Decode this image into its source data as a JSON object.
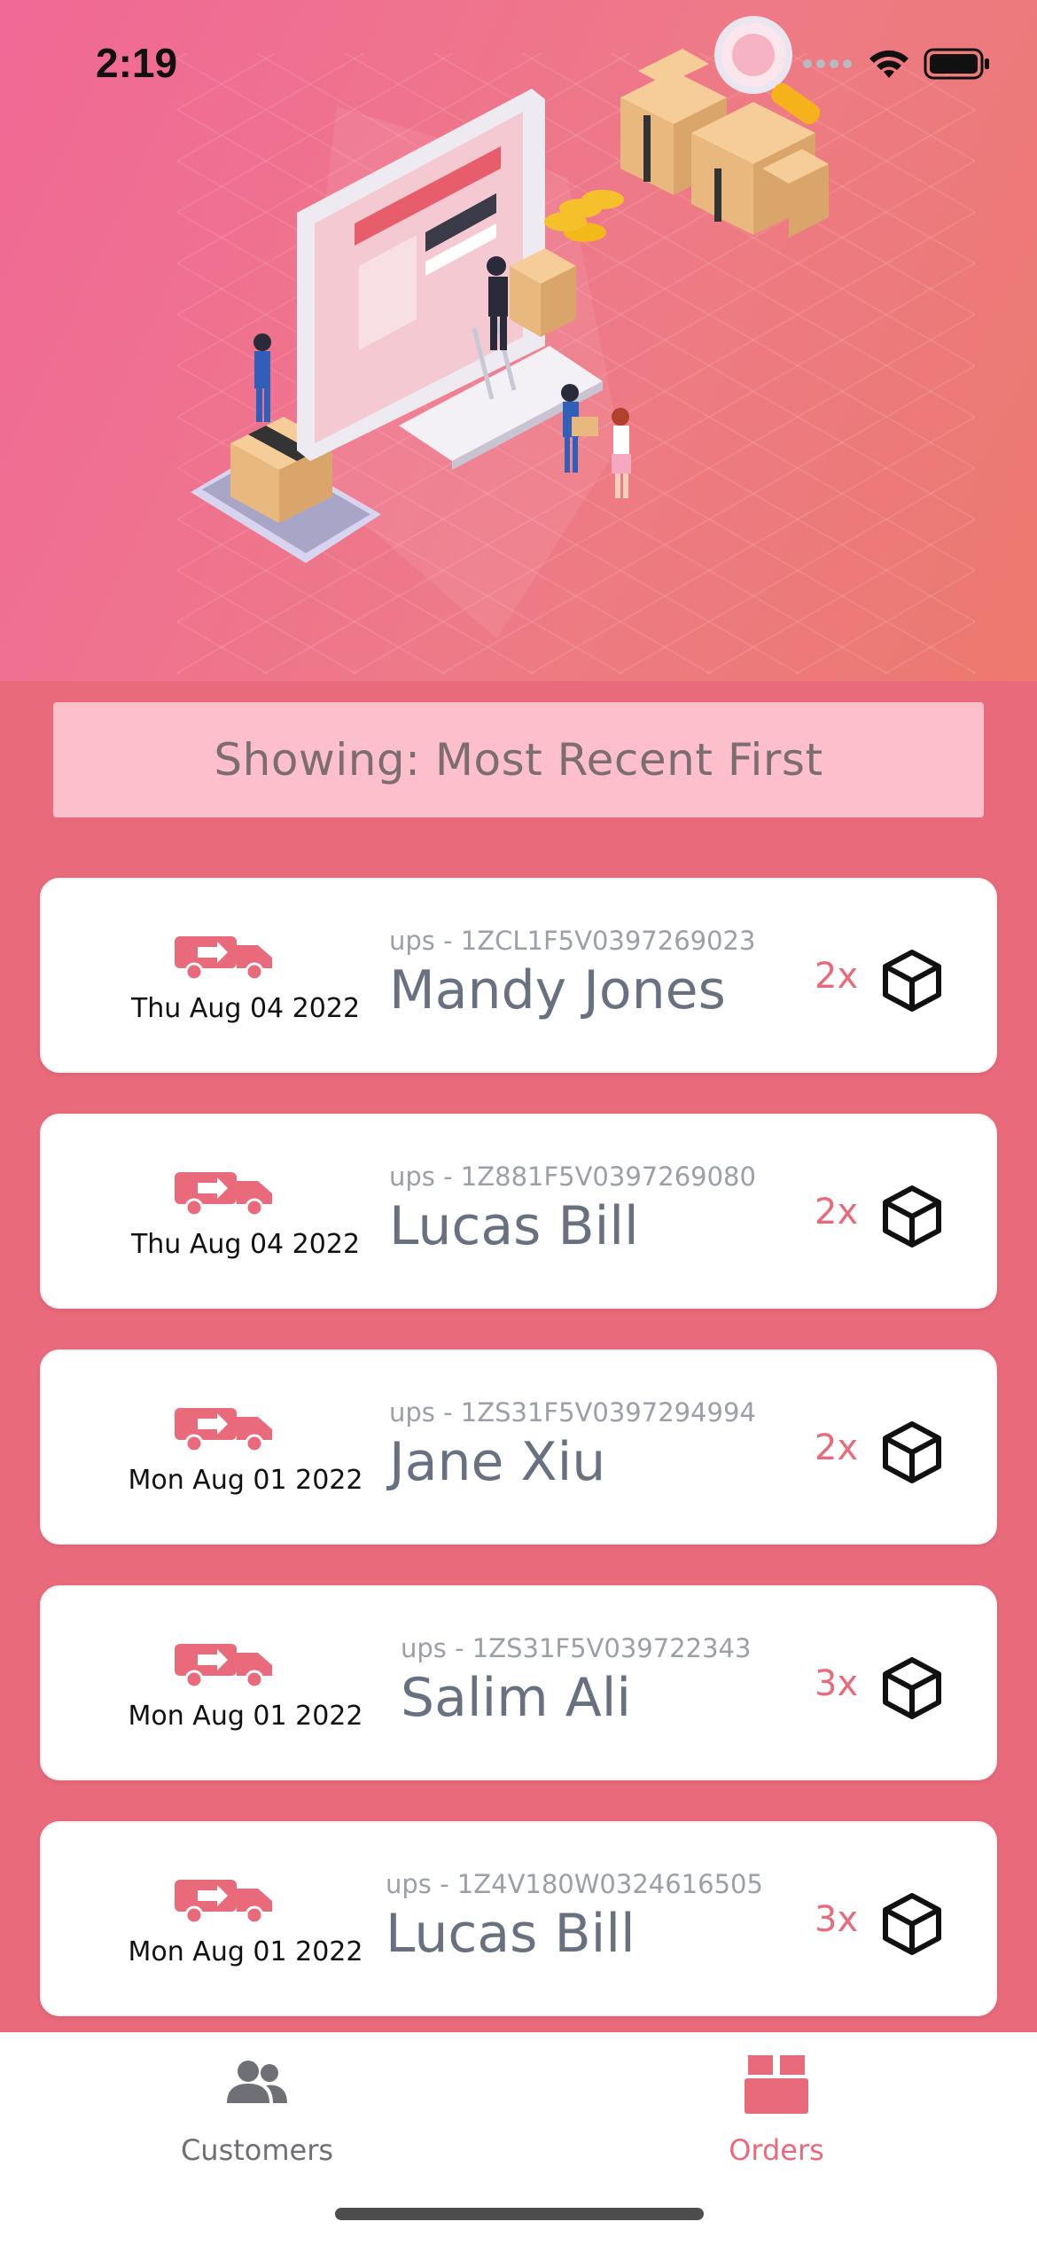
{
  "status_bar": {
    "time": "2:19"
  },
  "sort_banner": {
    "label": "Showing: Most Recent First"
  },
  "orders": [
    {
      "date": "Thu Aug 04 2022",
      "tracking": "ups - 1ZCL1F5V0397269023",
      "customer": "Mandy Jones",
      "quantity": "2x"
    },
    {
      "date": "Thu Aug 04 2022",
      "tracking": "ups - 1Z881F5V0397269080",
      "customer": "Lucas Bill",
      "quantity": "2x"
    },
    {
      "date": "Mon Aug 01 2022",
      "tracking": "ups - 1ZS31F5V0397294994",
      "customer": "Jane Xiu",
      "quantity": "2x"
    },
    {
      "date": "Mon Aug 01 2022",
      "tracking": "ups - 1ZS31F5V039722343",
      "customer": "Salim Ali",
      "quantity": "3x"
    },
    {
      "date": "Mon Aug 01 2022",
      "tracking": "ups - 1Z4V180W0324616505",
      "customer": "Lucas Bill",
      "quantity": "3x"
    }
  ],
  "tabbar": {
    "customers_label": "Customers",
    "orders_label": "Orders",
    "active": "orders"
  },
  "icons": {
    "truck": "delivery-truck-icon",
    "box": "package-box-icon",
    "customers": "people-icon",
    "orders": "box-icon"
  },
  "colors": {
    "accent": "#e96a7b",
    "banner": "#fdbfcc",
    "card": "#ffffff"
  }
}
